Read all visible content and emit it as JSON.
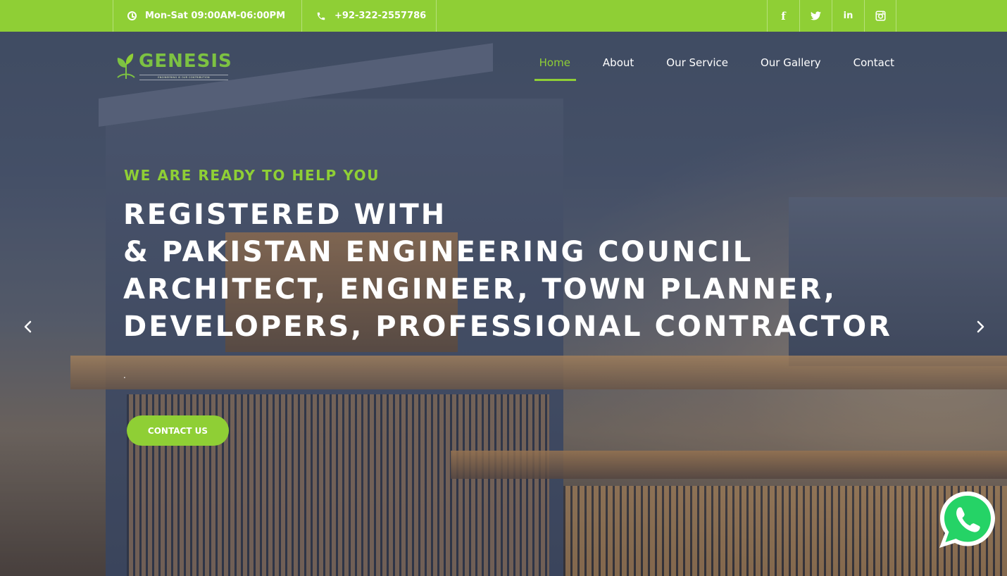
{
  "colors": {
    "accent": "#8fcf35",
    "text_light": "#ffffff",
    "logo_green": "#7dc242",
    "logo_blue": "#4aa5c9",
    "whatsapp": "#25d366"
  },
  "topbar": {
    "hours": "Mon-Sat 09:00AM-06:00PM",
    "phone": "+92-322-2557786",
    "hours_icon": "clock-icon",
    "phone_icon": "phone-icon",
    "socials": [
      {
        "name": "facebook",
        "glyph": "f"
      },
      {
        "name": "twitter",
        "glyph": "t"
      },
      {
        "name": "linkedin",
        "glyph": "in"
      },
      {
        "name": "instagram",
        "glyph": "◎"
      }
    ]
  },
  "logo": {
    "brand": "GENESIS",
    "tagline": "ENGINEERING IS OUR CONTRIBUTION"
  },
  "nav": {
    "active": "Home",
    "items": [
      "Home",
      "About",
      "Our Service",
      "Our Gallery",
      "Contact"
    ]
  },
  "hero": {
    "eyebrow": "WE ARE READY TO HELP YOU",
    "headline_lines": [
      "REGISTERED WITH",
      "& PAKISTAN ENGINEERING COUNCIL",
      "ARCHITECT, ENGINEER, TOWN PLANNER,",
      "DEVELOPERS, PROFESSIONAL CONTRACTOR"
    ],
    "subtext": ".",
    "cta_label": "CONTACT US"
  },
  "slider": {
    "prev_icon": "chevron-left-icon",
    "next_icon": "chevron-right-icon"
  },
  "whatsapp": {
    "icon": "whatsapp-icon"
  }
}
